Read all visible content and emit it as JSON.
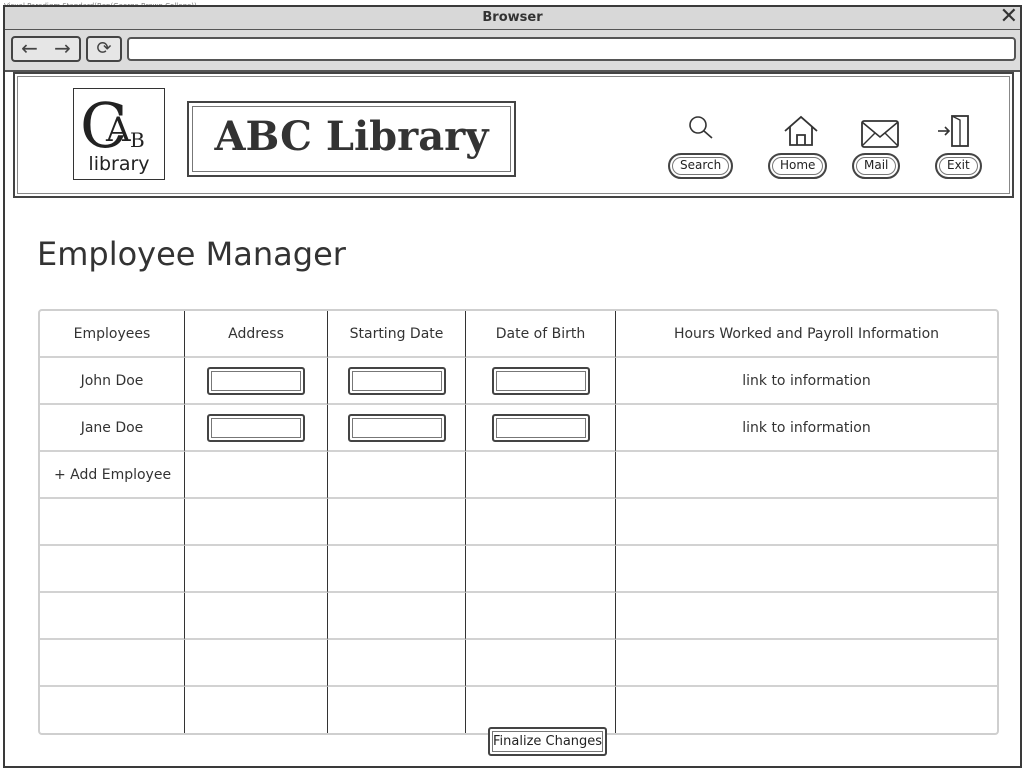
{
  "watermark": "Visual Paradigm Standard(Ben(George Brown College))",
  "browser": {
    "title": "Browser",
    "url": ""
  },
  "header": {
    "logo_text": "library",
    "logo_letters": "CAB",
    "brand": "ABC Library",
    "nav": [
      {
        "label": "Search",
        "icon": "search-icon"
      },
      {
        "label": "Home",
        "icon": "home-icon"
      },
      {
        "label": "Mail",
        "icon": "mail-icon"
      },
      {
        "label": "Exit",
        "icon": "exit-icon"
      }
    ]
  },
  "page": {
    "title": "Employee Manager"
  },
  "table": {
    "columns": [
      "Employees",
      "Address",
      "Starting Date",
      "Date of Birth",
      "Hours Worked and Payroll Information"
    ],
    "rows": [
      {
        "name": "John Doe",
        "address": "",
        "starting_date": "",
        "date_of_birth": "",
        "payroll_link": "link to information"
      },
      {
        "name": "Jane Doe",
        "address": "",
        "starting_date": "",
        "date_of_birth": "",
        "payroll_link": "link to information"
      }
    ],
    "add_label": "+ Add Employee",
    "empty_rows": 5
  },
  "actions": {
    "finalize_label": "Finalize Changes"
  }
}
